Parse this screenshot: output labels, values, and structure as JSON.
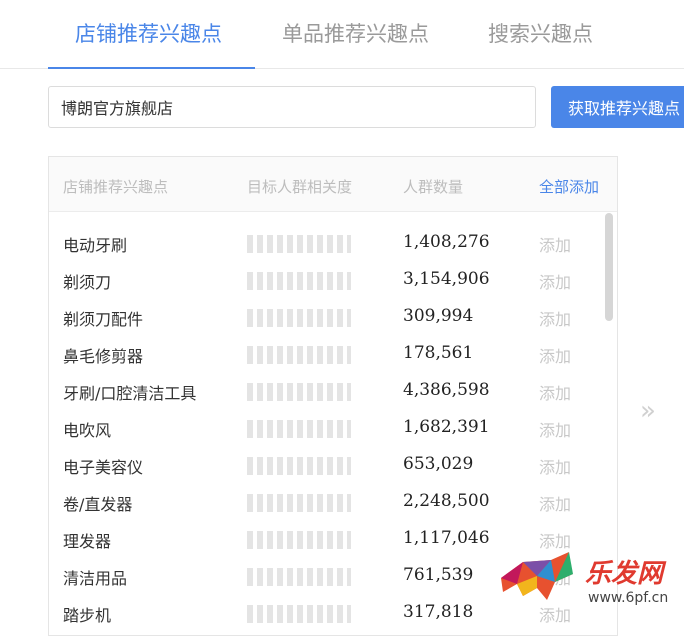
{
  "tabs": [
    {
      "label": "店铺推荐兴趣点",
      "active": true
    },
    {
      "label": "单品推荐兴趣点",
      "active": false
    },
    {
      "label": "搜索兴趣点",
      "active": false
    }
  ],
  "search": {
    "value": "博朗官方旗舰店",
    "button_label": "获取推荐兴趣点"
  },
  "table": {
    "headers": {
      "interest": "店铺推荐兴趣点",
      "relevance": "目标人群相关度",
      "count": "人群数量",
      "add_all": "全部添加"
    },
    "rows": [
      {
        "name": "电动牙刷",
        "count": "1,408,276",
        "action": "添加"
      },
      {
        "name": "剃须刀",
        "count": "3,154,906",
        "action": "添加"
      },
      {
        "name": "剃须刀配件",
        "count": "309,994",
        "action": "添加"
      },
      {
        "name": "鼻毛修剪器",
        "count": "178,561",
        "action": "添加"
      },
      {
        "name": "牙刷/口腔清洁工具",
        "count": "4,386,598",
        "action": "添加"
      },
      {
        "name": "电吹风",
        "count": "1,682,391",
        "action": "添加"
      },
      {
        "name": "电子美容仪",
        "count": "653,029",
        "action": "添加"
      },
      {
        "name": "卷/直发器",
        "count": "2,248,500",
        "action": "添加"
      },
      {
        "name": "理发器",
        "count": "1,117,046",
        "action": "添加"
      },
      {
        "name": "清洁用品",
        "count": "761,539",
        "action": "添加"
      },
      {
        "name": "踏步机",
        "count": "317,818",
        "action": "添加"
      }
    ]
  },
  "pager": {
    "next_icon": "double-chevron-right-icon",
    "glyph": "»"
  },
  "watermark": {
    "brand": "乐发网",
    "url": "www.6pf.cn"
  },
  "colors": {
    "accent": "#4a86e8",
    "muted": "#c8c8c8",
    "brand_red": "#e03a2f"
  }
}
